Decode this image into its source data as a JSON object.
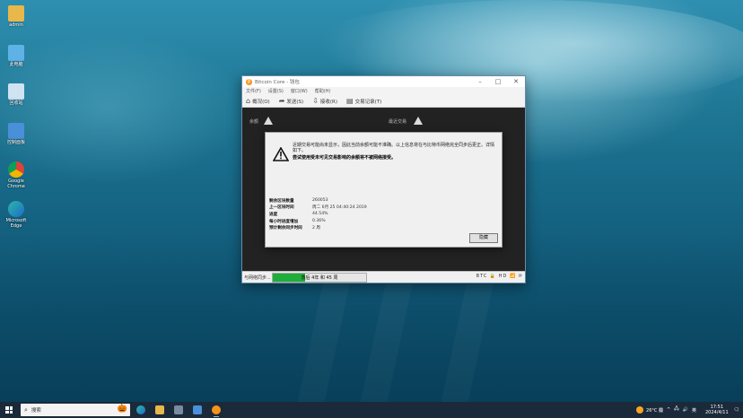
{
  "desktop_icons": [
    {
      "label": "admin",
      "icon": "folder-user-icon",
      "color": "#e8b84a"
    },
    {
      "label": "此电脑",
      "icon": "computer-icon",
      "color": "#5fb2e6"
    },
    {
      "label": "回收站",
      "icon": "recycle-bin-icon",
      "color": "#cfe3f2"
    },
    {
      "label": "控制面板",
      "icon": "control-panel-icon",
      "color": "#4a90d9"
    },
    {
      "label": "Google Chrome",
      "icon": "chrome-icon",
      "color": "#db4437"
    },
    {
      "label": "Microsoft Edge",
      "icon": "edge-icon",
      "color": "#2fb5a6"
    }
  ],
  "window": {
    "title": "Bitcoin Core - 钱包",
    "menu": [
      "文件(F)",
      "设置(S)",
      "窗口(W)",
      "帮助(H)"
    ],
    "toolbar": [
      {
        "label": "概况(O)",
        "icon": "home-icon"
      },
      {
        "label": "发送(S)",
        "icon": "send-icon"
      },
      {
        "label": "接收(R)",
        "icon": "receive-icon"
      },
      {
        "label": "交易记录(T)",
        "icon": "transactions-icon"
      }
    ],
    "content_labels": {
      "balances": "余额",
      "recent": "最近交易"
    },
    "statusbar": {
      "status": "与网络同步...",
      "progress_text": "落后 4年 和 45 周",
      "progress_fraction": 0.35,
      "unit": "BTC"
    }
  },
  "modal": {
    "message1": "近期交易可能尚未显示，因此当前余额可能不准确。以上信息将在与比特币网络完全同步后更正。详情如下。",
    "message2": "尝试使用受未可见交易影响的余额将不被网络接受。",
    "rows": [
      {
        "key": "剩余区块数量",
        "value": "260053"
      },
      {
        "key": "上一区块时间",
        "value": "周二 6月 25 04:40:24 2019"
      },
      {
        "key": "进度",
        "value": "44.54%"
      },
      {
        "key": "每小时进度增加",
        "value": "0.36%"
      },
      {
        "key": "预计剩余同步时间",
        "value": "2 周"
      }
    ],
    "hide_button": "隐藏"
  },
  "taskbar": {
    "search_placeholder": "搜索",
    "apps": [
      {
        "name": "edge",
        "color": "#2fb5a6"
      },
      {
        "name": "file-explorer",
        "color": "#e8b84a"
      },
      {
        "name": "store",
        "color": "#7a8aa0"
      },
      {
        "name": "mail",
        "color": "#4a90d9"
      },
      {
        "name": "bitcoin-core",
        "color": "#f7931a"
      }
    ],
    "weather": "26°C 霾",
    "ime": "英",
    "time": "17:51",
    "date": "2024/4/11"
  }
}
